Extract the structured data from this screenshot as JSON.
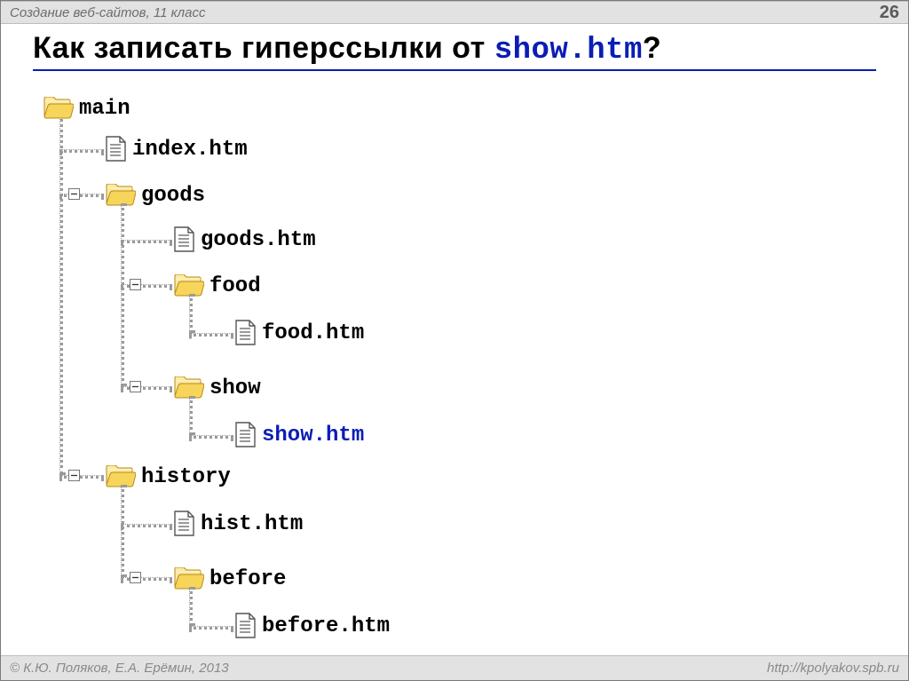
{
  "header": {
    "course": "Создание веб-сайтов, 11 класс",
    "page_number": "26"
  },
  "title": {
    "prefix": "Как записать гиперссылки от ",
    "filename": "show.htm",
    "suffix": "?"
  },
  "tree": {
    "main": "main",
    "index": "index.htm",
    "goods": "goods",
    "goods_htm": "goods.htm",
    "food": "food",
    "food_htm": "food.htm",
    "show": "show",
    "show_htm": "show.htm",
    "history": "history",
    "hist_htm": "hist.htm",
    "before": "before",
    "before_htm": "before.htm"
  },
  "footer": {
    "copyright": "© К.Ю. Поляков, Е.А. Ерёмин, 2013",
    "url": "http://kpolyakov.spb.ru"
  }
}
